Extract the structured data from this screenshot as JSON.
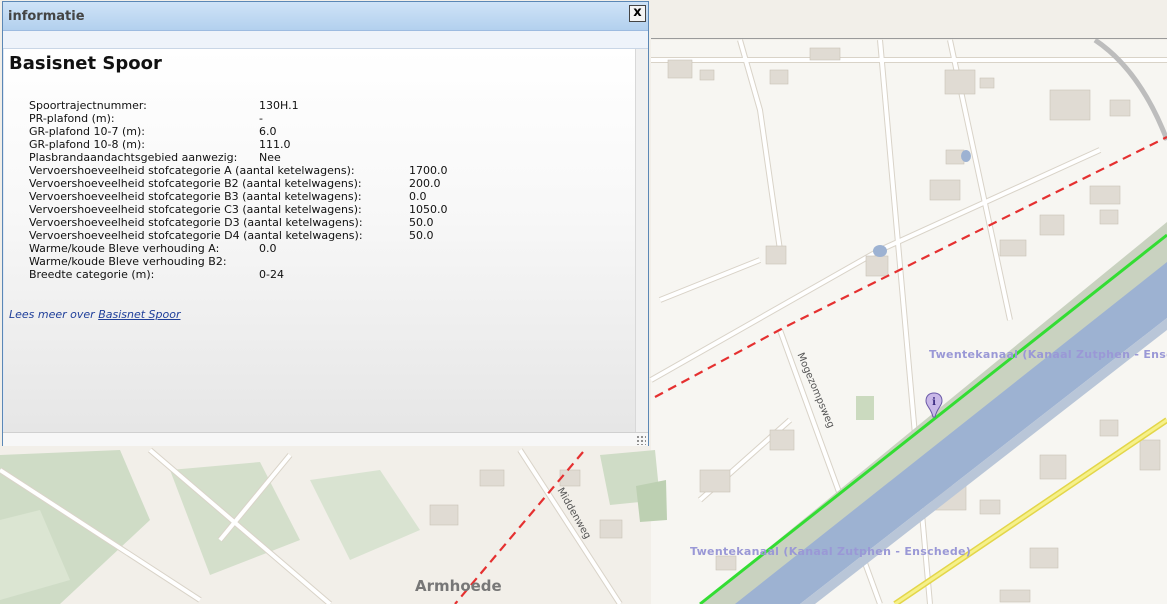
{
  "window": {
    "title": "informatie",
    "close_label": "x",
    "heading": "Basisnet Spoor",
    "attributes": [
      {
        "label": "Spoortrajectnummer:",
        "value": "130H.1"
      },
      {
        "label": "PR-plafond (m):",
        "value": "-"
      },
      {
        "label": "GR-plafond 10-7 (m):",
        "value": "6.0"
      },
      {
        "label": "GR-plafond 10-8 (m):",
        "value": "111.0"
      },
      {
        "label": "Plasbrandaandachtsgebied aanwezig:",
        "value": "Nee"
      },
      {
        "label": "Vervoershoeveelheid stofcategorie A (aantal ketelwagens):",
        "value": "1700.0"
      },
      {
        "label": "Vervoershoeveelheid stofcategorie B2 (aantal ketelwagens):",
        "value": "200.0"
      },
      {
        "label": "Vervoershoeveelheid stofcategorie B3 (aantal ketelwagens):",
        "value": "0.0"
      },
      {
        "label": "Vervoershoeveelheid stofcategorie C3 (aantal ketelwagens):",
        "value": "1050.0"
      },
      {
        "label": "Vervoershoeveelheid stofcategorie D3 (aantal ketelwagens):",
        "value": "50.0"
      },
      {
        "label": "Vervoershoeveelheid stofcategorie D4 (aantal ketelwagens):",
        "value": "50.0"
      },
      {
        "label": "Warme/koude Bleve verhouding A:",
        "value": "0.0"
      },
      {
        "label": "Warme/koude Bleve verhouding B2:",
        "value": ""
      },
      {
        "label": "Breedte categorie (m):",
        "value": "0-24"
      }
    ],
    "more_prefix": "Lees meer over ",
    "more_link": "Basisnet Spoor"
  },
  "map": {
    "canal_label_1": "Twentekanaal (Kanaal Zutphen - Enschede)",
    "canal_label_2": "Twentekanaal (Kanaal Zutphen - Enschede)",
    "road_label_1": "Mogezompsweg",
    "road_label_2": "Middenweg",
    "place_label": "Armhoede"
  },
  "colors": {
    "railway_dash": "#e53030",
    "canal": "#9db2d2",
    "green_line": "#33dd33",
    "yellow_road": "#f2ee6a",
    "window_border": "#5b87b5",
    "link": "#1f3f9a"
  },
  "icons": [
    "close-icon",
    "info-marker-icon",
    "resize-grip-icon"
  ]
}
